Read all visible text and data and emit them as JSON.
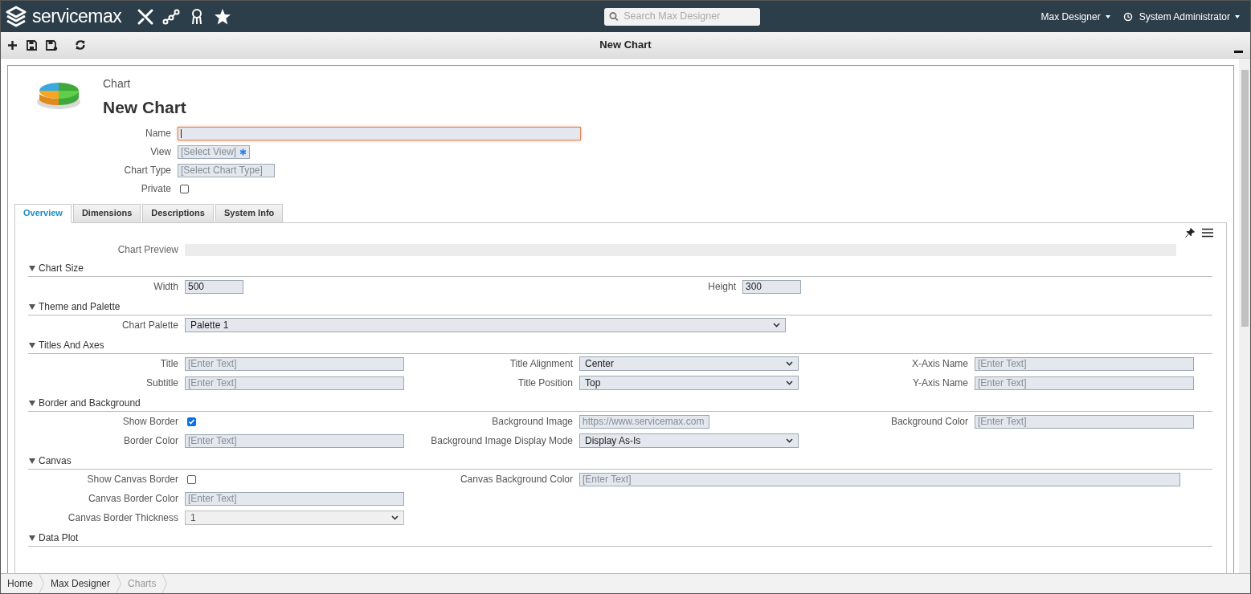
{
  "app_bar": {
    "brand": "servicemax",
    "search": {
      "placeholder": "Search Max Designer"
    },
    "menus": [
      {
        "label": "Max Designer"
      },
      {
        "label": "System Administrator"
      }
    ]
  },
  "toolbar": {
    "title": "New Chart"
  },
  "record": {
    "type": "Chart",
    "title": "New Chart",
    "fields": [
      {
        "label": "Name",
        "kind": "text",
        "focused": true
      },
      {
        "label": "View",
        "kind": "lookup",
        "placeholder": "[Select View]"
      },
      {
        "label": "Chart Type",
        "kind": "text",
        "placeholder": "[Select Chart Type]"
      },
      {
        "label": "Private",
        "kind": "checkbox",
        "checked": false
      }
    ]
  },
  "tabs": [
    {
      "label": "Overview",
      "selected": true
    },
    {
      "label": "Dimensions",
      "selected": false
    },
    {
      "label": "Descriptions",
      "selected": false
    },
    {
      "label": "System Info",
      "selected": false
    }
  ],
  "preview": {
    "label": "Chart Preview"
  },
  "sections": [
    {
      "title": "Chart Size",
      "expanded": true,
      "rows": [
        [
          {
            "label": "Width",
            "kind": "text",
            "value": "500"
          },
          {
            "label": "Height",
            "kind": "text",
            "value": "300"
          }
        ]
      ]
    },
    {
      "title": "Theme and Palette",
      "expanded": true,
      "rows": [
        [
          {
            "label": "Chart Palette",
            "kind": "select",
            "value": "Palette 1"
          }
        ]
      ]
    },
    {
      "title": "Titles And Axes",
      "expanded": true,
      "rows": [
        [
          {
            "label": "Title",
            "kind": "text",
            "placeholder": "[Enter Text]"
          },
          {
            "label": "Title Alignment",
            "kind": "select",
            "value": "Center"
          },
          {
            "label": "X-Axis Name",
            "kind": "text",
            "placeholder": "[Enter Text]"
          }
        ],
        [
          {
            "label": "Subtitle",
            "kind": "text",
            "placeholder": "[Enter Text]"
          },
          {
            "label": "Title Position",
            "kind": "select",
            "value": "Top"
          },
          {
            "label": "Y-Axis Name",
            "kind": "text",
            "placeholder": "[Enter Text]"
          }
        ]
      ]
    },
    {
      "title": "Border and Background",
      "expanded": true,
      "rows": [
        [
          {
            "label": "Show Border",
            "kind": "checkbox",
            "checked": true
          },
          {
            "label": "Background Image",
            "kind": "text",
            "placeholder": "https://www.servicemax.com"
          },
          {
            "label": "Background Color",
            "kind": "text",
            "placeholder": "[Enter Text]"
          }
        ],
        [
          {
            "label": "Border Color",
            "kind": "text",
            "placeholder": "[Enter Text]"
          },
          {
            "label": "Background Image Display Mode",
            "kind": "select",
            "value": "Display As-Is"
          }
        ]
      ]
    },
    {
      "title": "Canvas",
      "expanded": true,
      "rows": [
        [
          {
            "label": "Show Canvas Border",
            "kind": "checkbox",
            "checked": false
          },
          {
            "label": "Canvas Background Color",
            "kind": "text",
            "placeholder": "[Enter Text]"
          }
        ],
        [
          {
            "label": "Canvas Border Color",
            "kind": "text",
            "placeholder": "[Enter Text]"
          }
        ],
        [
          {
            "label": "Canvas Border Thickness",
            "kind": "select",
            "value": "1",
            "disabled": true
          }
        ]
      ]
    },
    {
      "title": "Data Plot",
      "expanded": true
    }
  ],
  "breadcrumb": [
    {
      "label": "Home",
      "current": false
    },
    {
      "label": "Max Designer",
      "current": false
    },
    {
      "label": "Charts",
      "current": true
    }
  ]
}
